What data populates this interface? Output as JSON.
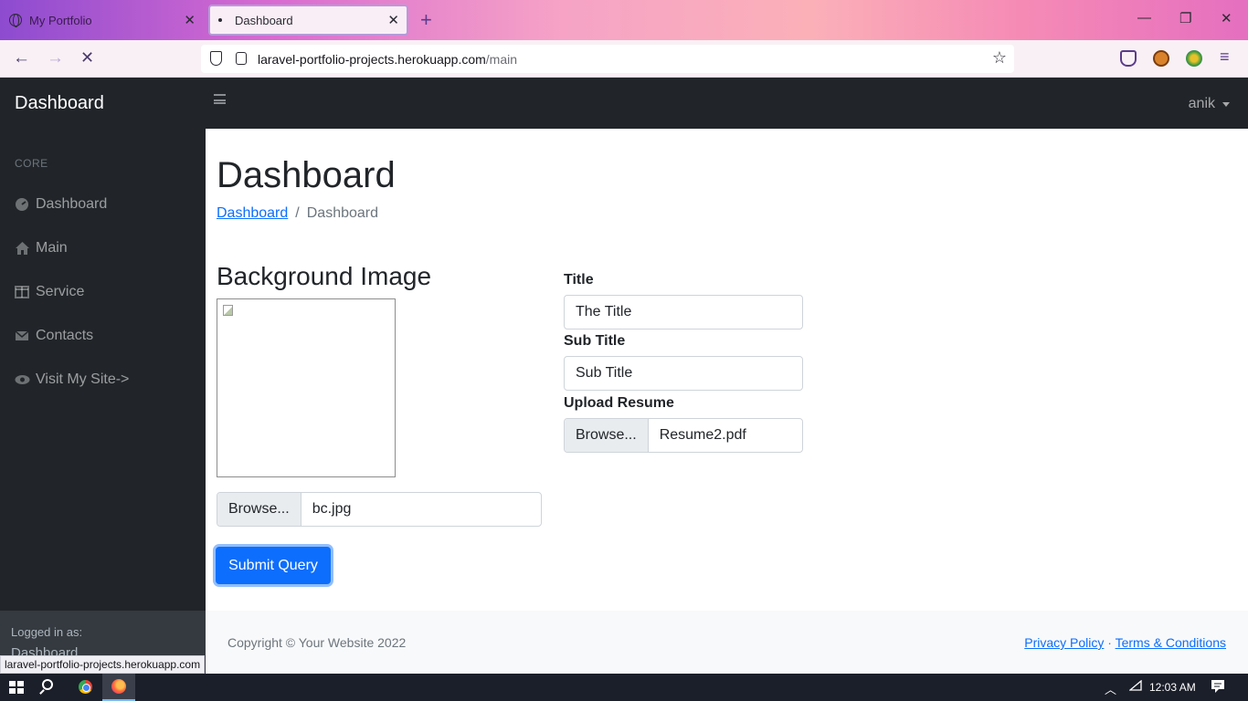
{
  "browser": {
    "tabs": [
      {
        "title": "My Portfolio"
      },
      {
        "title": "Dashboard"
      }
    ],
    "url_host": "laravel-portfolio-projects.herokuapp.com",
    "url_path": "/main",
    "status_url": "laravel-portfolio-projects.herokuapp.com"
  },
  "app": {
    "brand": "Dashboard",
    "user": "anik"
  },
  "sidebar": {
    "heading": "CORE",
    "items": [
      {
        "label": "Dashboard",
        "icon": "gauge-icon"
      },
      {
        "label": "Main",
        "icon": "home-icon"
      },
      {
        "label": "Service",
        "icon": "columns-icon"
      },
      {
        "label": "Contacts",
        "icon": "envelope-icon"
      },
      {
        "label": "Visit My Site->",
        "icon": "eye-icon"
      }
    ],
    "footer_small": "Logged in as:",
    "footer_name": "Dashboard"
  },
  "main": {
    "title": "Dashboard",
    "breadcrumb_link": "Dashboard",
    "breadcrumb_current": "Dashboard",
    "bg_heading": "Background Image",
    "bg_file_button": "Browse...",
    "bg_file_name": "bc.jpg",
    "title_label": "Title",
    "title_value": "The Title",
    "subtitle_label": "Sub Title",
    "subtitle_value": "Sub Title",
    "resume_label": "Upload Resume",
    "resume_file_button": "Browse...",
    "resume_file_name": "Resume2.pdf",
    "submit_label": "Submit Query"
  },
  "footer": {
    "copyright": "Copyright © Your Website 2022",
    "privacy": "Privacy Policy",
    "separator": "·",
    "terms": "Terms & Conditions"
  },
  "taskbar": {
    "time": "12:03 AM"
  },
  "colors": {
    "primary": "#0d6efd",
    "sidebar_bg": "#212529",
    "sidebar_footer_bg": "#343a40"
  }
}
